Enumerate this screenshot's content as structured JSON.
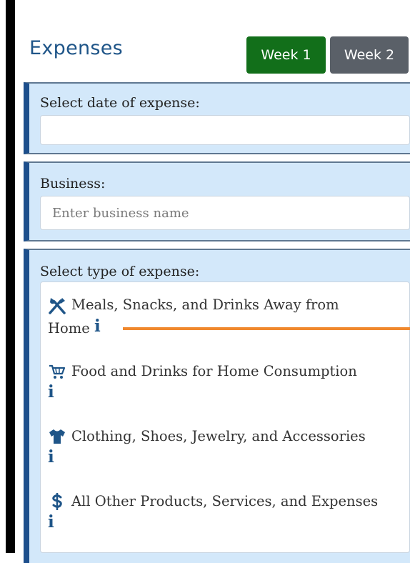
{
  "header": {
    "title": "Expenses",
    "tabs": [
      {
        "label": "Week 1",
        "active": true,
        "color": "#126f1a"
      },
      {
        "label": "Week 2",
        "active": false,
        "color": "#5a6068"
      }
    ]
  },
  "date_section": {
    "label": "Select date of expense:",
    "value": ""
  },
  "business_section": {
    "label": "Business:",
    "placeholder": "Enter business name",
    "value": ""
  },
  "type_section": {
    "label": "Select type of expense:",
    "options": [
      {
        "icon": "fork-knife-icon",
        "label_line1": "Meals, Snacks, and Drinks Away from",
        "label_line2": "Home",
        "info": "i"
      },
      {
        "icon": "shopping-cart-icon",
        "label_line1": "Food and Drinks for Home Consumption",
        "info": "i"
      },
      {
        "icon": "tshirt-icon",
        "label_line1": "Clothing, Shoes, Jewelry, and Accessories",
        "info": "i"
      },
      {
        "icon": "dollar-icon",
        "label_line1": "All Other Products, Services, and Expenses",
        "info": "i"
      }
    ]
  },
  "colors": {
    "accent": "#1f5588",
    "panel_bg": "#d3e8fa",
    "panel_border": "#1d4f8c",
    "annotation": "#f0882d"
  }
}
